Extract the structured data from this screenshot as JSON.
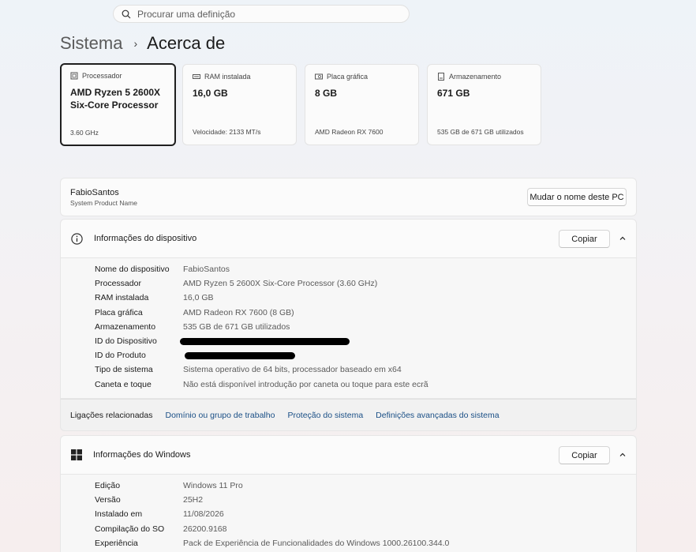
{
  "search": {
    "placeholder": "Procurar uma definição"
  },
  "breadcrumb": {
    "parent": "Sistema",
    "separator": "›",
    "current": "Acerca de"
  },
  "spec_cards": [
    {
      "label": "Processador",
      "value": "AMD Ryzen 5 2600X Six-Core Processor",
      "sub": "3.60 GHz",
      "icon": "cpu-icon"
    },
    {
      "label": "RAM instalada",
      "value": "16,0 GB",
      "sub": "Velocidade: 2133 MT/s",
      "icon": "ram-icon"
    },
    {
      "label": "Placa gráfica",
      "value": "8 GB",
      "sub": "AMD Radeon RX 7600",
      "icon": "gpu-icon"
    },
    {
      "label": "Armazenamento",
      "value": "671 GB",
      "sub": "535 GB de 671 GB utilizados",
      "icon": "storage-icon"
    }
  ],
  "device_name": {
    "name": "FabioSantos",
    "subtitle": "System Product Name",
    "rename_label": "Mudar o nome deste PC"
  },
  "device_info": {
    "title": "Informações do dispositivo",
    "copy_label": "Copiar",
    "rows": [
      {
        "key": "Nome do dispositivo",
        "value": "FabioSantos"
      },
      {
        "key": "Processador",
        "value": "AMD Ryzen 5 2600X Six-Core Processor (3.60 GHz)"
      },
      {
        "key": "RAM instalada",
        "value": "16,0 GB"
      },
      {
        "key": "Placa gráfica",
        "value": "AMD Radeon RX 7600 (8 GB)"
      },
      {
        "key": "Armazenamento",
        "value": "535 GB de 671 GB utilizados"
      },
      {
        "key": "ID do Dispositivo",
        "value": ""
      },
      {
        "key": "ID do Produto",
        "value": ""
      },
      {
        "key": "Tipo de sistema",
        "value": "Sistema operativo de 64 bits, processador baseado em x64"
      },
      {
        "key": "Caneta e toque",
        "value": "Não está disponível introdução por caneta ou toque para este ecrã"
      }
    ]
  },
  "related": {
    "label": "Ligações relacionadas",
    "links": [
      "Domínio ou grupo de trabalho",
      "Proteção do sistema",
      "Definições avançadas do sistema"
    ]
  },
  "windows_info": {
    "title": "Informações do Windows",
    "copy_label": "Copiar",
    "rows": [
      {
        "key": "Edição",
        "value": "Windows 11 Pro"
      },
      {
        "key": "Versão",
        "value": "25H2"
      },
      {
        "key": "Instalado em",
        "value": "11/08/2026"
      },
      {
        "key": "Compilação do SO",
        "value": "26200.9168"
      },
      {
        "key": "Experiência",
        "value": "Pack de Experiência de Funcionalidades do Windows 1000.26100.344.0"
      }
    ]
  },
  "colors": {
    "link": "#1a4f86",
    "selected_border": "#1f1f1f"
  }
}
